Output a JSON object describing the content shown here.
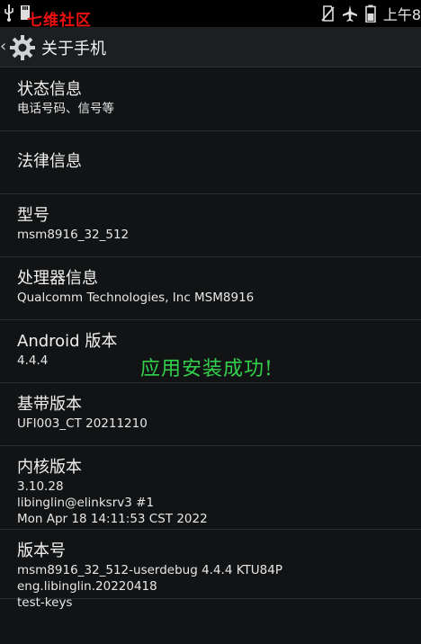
{
  "status_bar": {
    "watermark": "七维社区",
    "time": "上午8"
  },
  "action_bar": {
    "title": "关于手机"
  },
  "settings": {
    "items": [
      {
        "title": "状态信息",
        "subtitle": "电话号码、信号等"
      },
      {
        "title": "法律信息",
        "subtitle": ""
      },
      {
        "title": "型号",
        "subtitle": "msm8916_32_512"
      },
      {
        "title": "处理器信息",
        "subtitle": "Qualcomm Technologies, Inc MSM8916"
      },
      {
        "title": "Android 版本",
        "subtitle": "4.4.4"
      },
      {
        "title": "基带版本",
        "subtitle": "UFI003_CT 20211210"
      },
      {
        "title": "内核版本",
        "subtitle": "3.10.28\nlibinglin@elinksrv3 #1\nMon Apr 18 14:11:53 CST 2022"
      },
      {
        "title": "版本号",
        "subtitle": "msm8916_32_512-userdebug 4.4.4 KTU84P eng.libinglin.20220418\ntest-keys"
      }
    ]
  },
  "overlay": {
    "message": "应用安装成功!"
  },
  "icons": {
    "usb": "usb-icon",
    "sd": "sd-card-icon",
    "no_sim": "no-sim-icon",
    "airplane": "airplane-icon",
    "battery": "battery-icon",
    "settings": "settings-gear-icon",
    "back": "back-chevron-icon"
  },
  "colors": {
    "background": "#111315",
    "status_bar": "#000000",
    "action_bar": "#1c1f22",
    "watermark": "#ee1111",
    "overlay_text": "#33d04b"
  }
}
